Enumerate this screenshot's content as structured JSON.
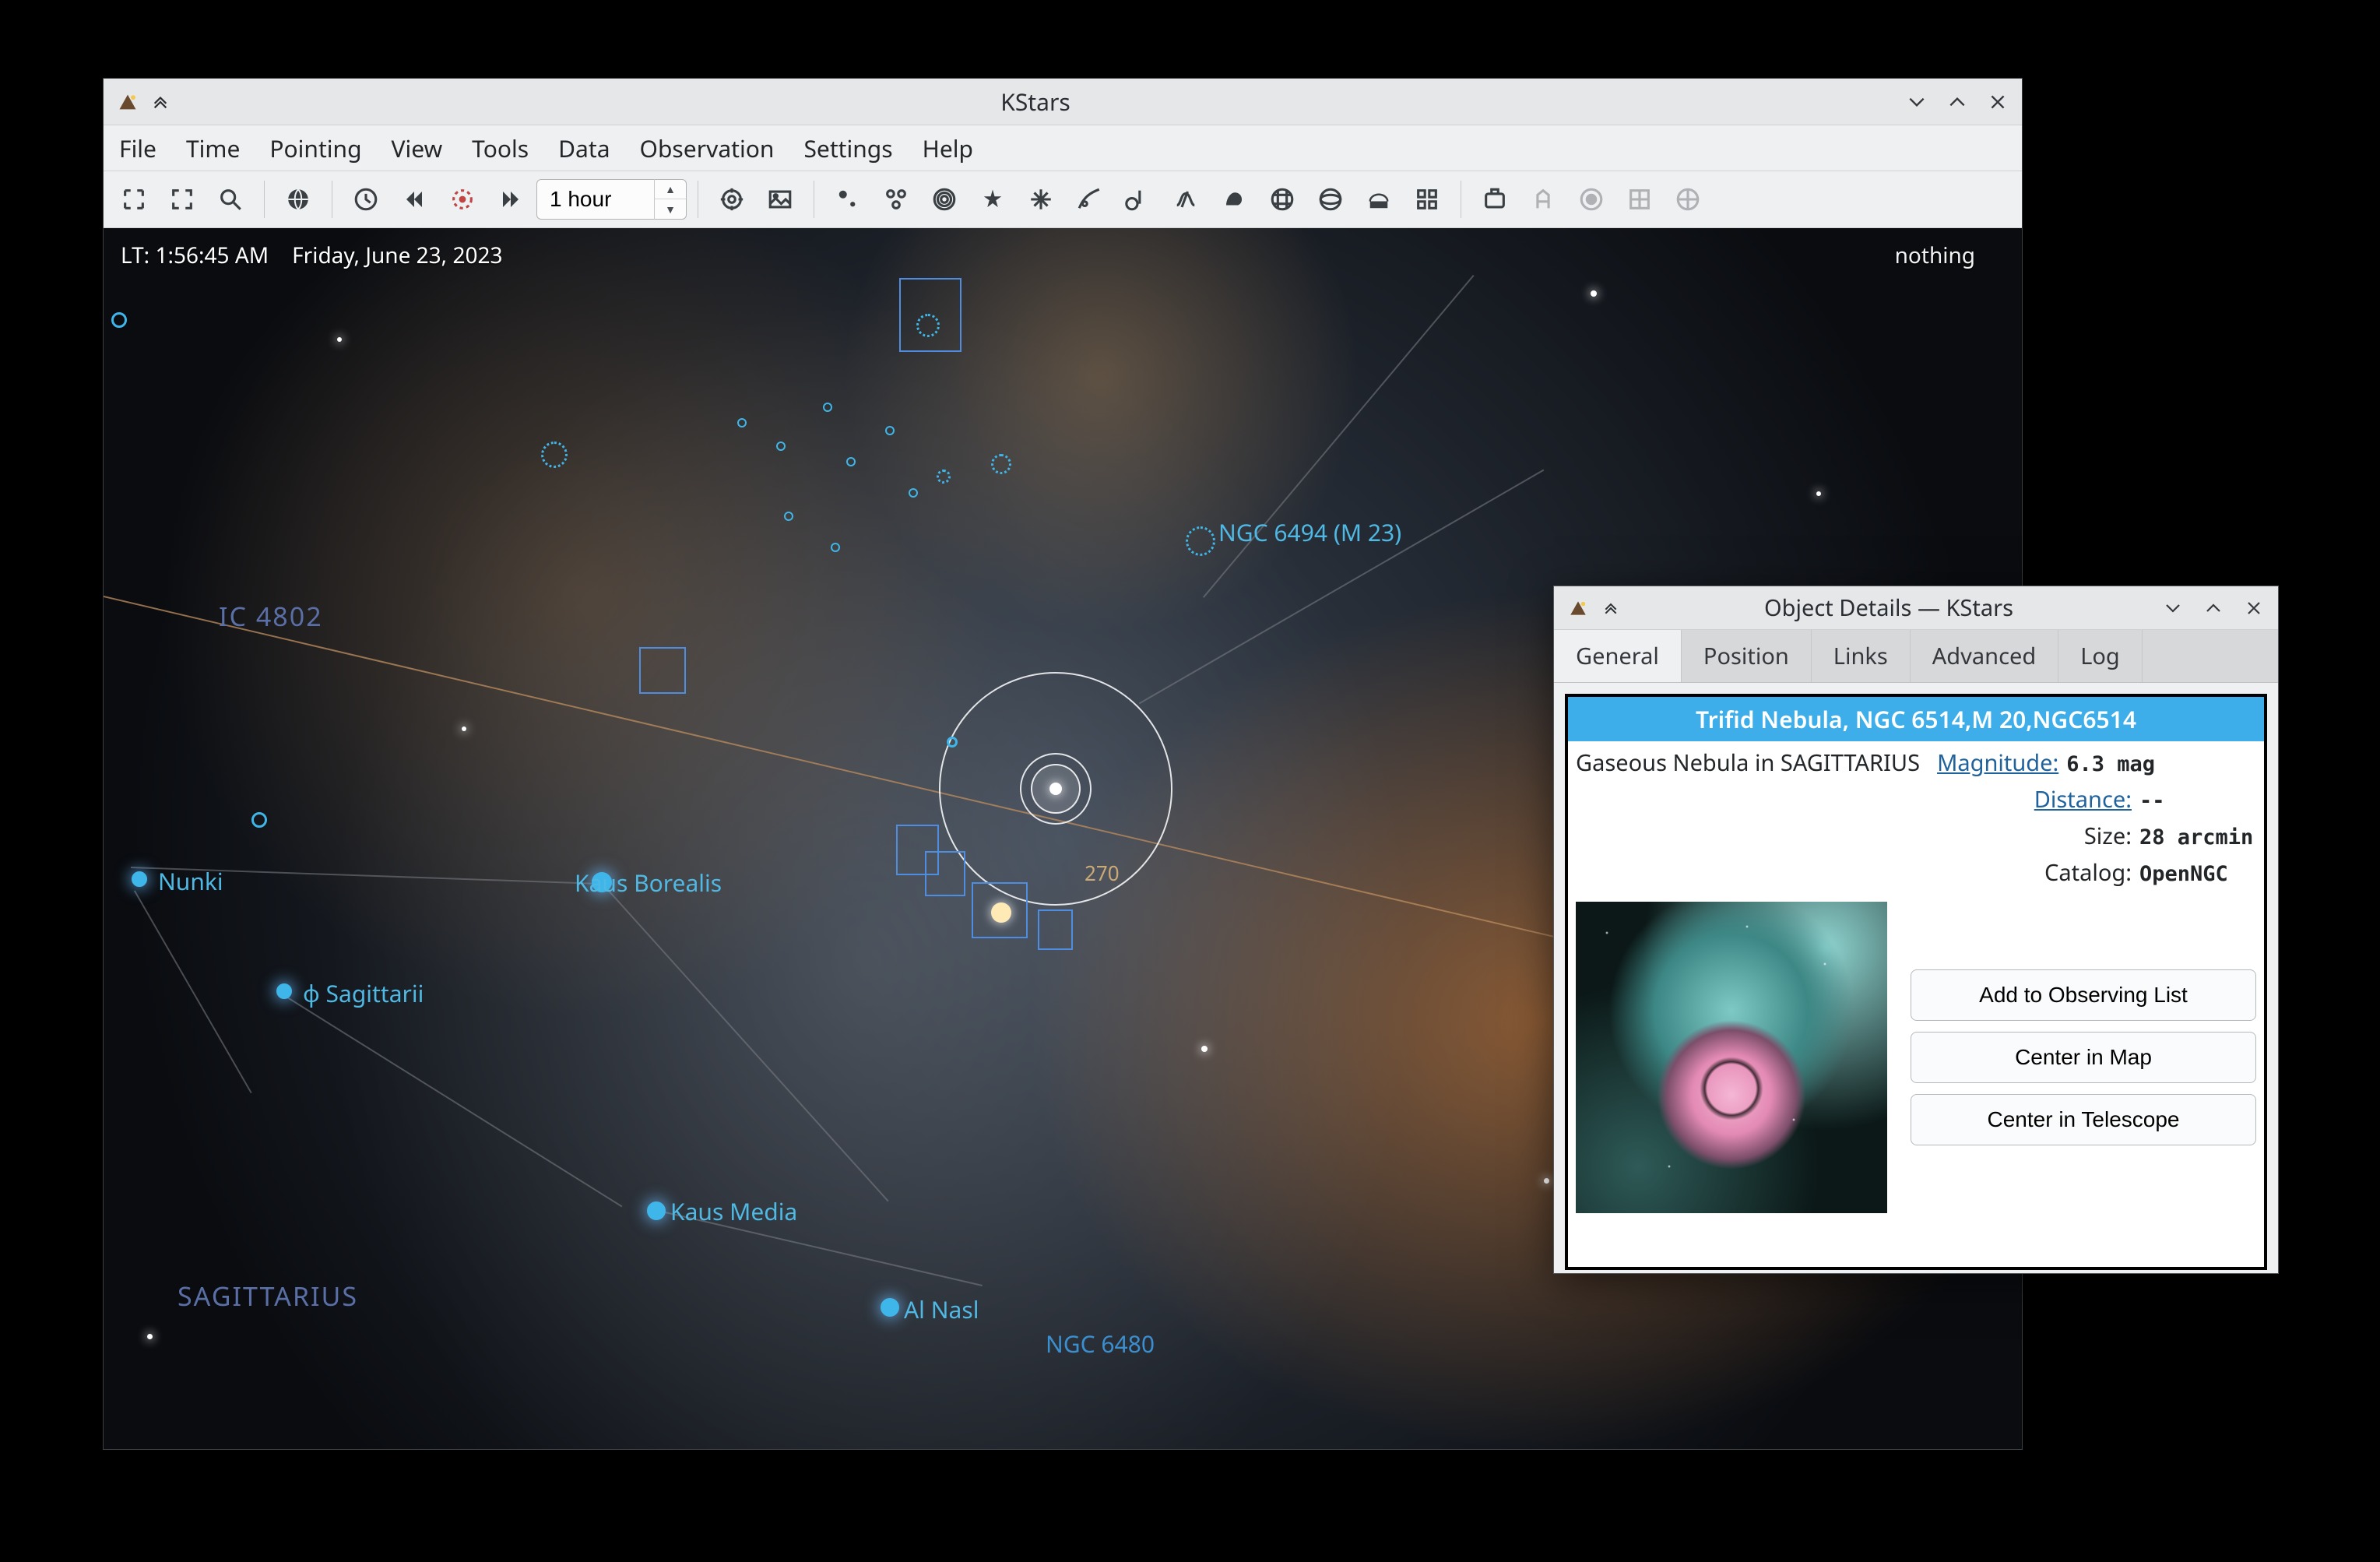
{
  "main_window": {
    "title": "KStars",
    "menu": [
      "File",
      "Time",
      "Pointing",
      "View",
      "Tools",
      "Data",
      "Observation",
      "Settings",
      "Help"
    ],
    "time_step": "1 hour",
    "hud": {
      "lt": "LT: 1:56:45 AM",
      "date": "Friday, June 23, 2023",
      "pointer": "nothing"
    },
    "sky_labels": {
      "ngc6494": "NGC 6494 (M 23)",
      "ic4802": "IC 4802",
      "nunki": "Nunki",
      "phi_sgr": "φ Sagittarii",
      "kaus_borealis": "Kaus Borealis",
      "kaus_media": "Kaus Media",
      "al_nasl": "Al Nasl",
      "sagittarius": "SAGITTARIUS",
      "ngc6480": "NGC 6480",
      "ecl_270": "270"
    }
  },
  "dialog": {
    "title": "Object Details — KStars",
    "tabs": [
      "General",
      "Position",
      "Links",
      "Advanced",
      "Log"
    ],
    "active_tab": "General",
    "object_title": "Trifid Nebula, NGC 6514,M 20,NGC6514",
    "type_line": "Gaseous Nebula in SAGITTARIUS",
    "rows": {
      "magnitude": {
        "label": "Magnitude:",
        "value": "6.3 mag"
      },
      "distance": {
        "label": "Distance:",
        "value": "--"
      },
      "size": {
        "label": "Size:",
        "value": "28 arcmin"
      },
      "catalog": {
        "label": "Catalog:",
        "value": "OpenNGC"
      }
    },
    "buttons": {
      "add": "Add to Observing List",
      "center_map": "Center in Map",
      "center_tele": "Center in Telescope"
    }
  }
}
